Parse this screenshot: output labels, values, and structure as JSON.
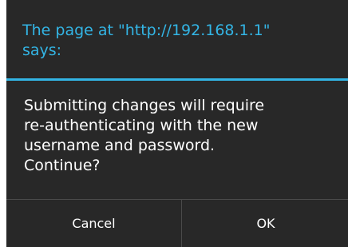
{
  "dialog": {
    "title": "The page at \"http://192.168.1.1\"\nsays:",
    "message": "Submitting changes will require\nre-authenticating with the new\nusername and password.\nContinue?",
    "cancel_label": "Cancel",
    "ok_label": "OK"
  },
  "colors": {
    "accent": "#33b5e5",
    "dialog_background": "#282828",
    "text": "#ffffff",
    "divider": "#4a4a4a"
  }
}
